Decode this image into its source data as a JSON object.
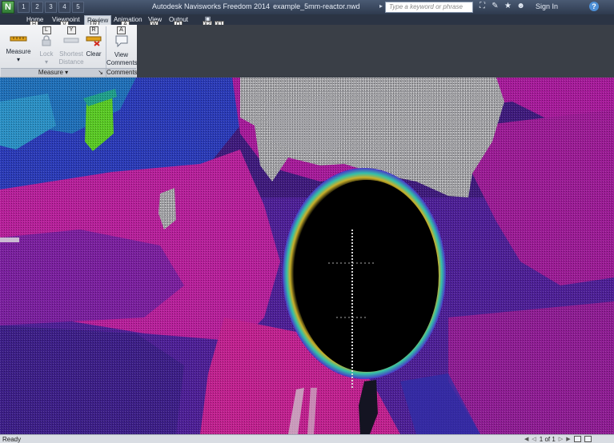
{
  "titlebar": {
    "app_menu_label": "N",
    "qat_keytips": [
      "1",
      "2",
      "3",
      "4",
      "5"
    ],
    "app_name": "Autodesk Navisworks Freedom 2014",
    "file_name": "example_5mm-reactor.nwd",
    "search_placeholder": "Type a keyword or phrase",
    "sign_in": "Sign In",
    "help": "?"
  },
  "tabs": [
    {
      "label": "Home",
      "keytip": "H",
      "active": false
    },
    {
      "label": "Viewpoint",
      "keytip": "V",
      "active": false
    },
    {
      "label": "Review",
      "keytip": "R",
      "active": true
    },
    {
      "label": "Animation",
      "keytip": "A",
      "active": false
    },
    {
      "label": "View",
      "keytip": "W",
      "active": false
    },
    {
      "label": "Output",
      "keytip": "O",
      "active": false
    }
  ],
  "extra_keytips": [
    "X2",
    "X1"
  ],
  "ribbon": {
    "measure": {
      "label": "Measure",
      "arrow": "▾"
    },
    "lock": {
      "label": "Lock",
      "arrow": "▾",
      "keytip": "L"
    },
    "shortest_distance": {
      "line1": "Shortest",
      "line2": "Distance",
      "keytip": "Y"
    },
    "clear": {
      "label": "Clear",
      "keytip": "R"
    },
    "view_comments": {
      "line1": "View",
      "line2": "Comments",
      "keytip": "A"
    },
    "panel_measure": "Measure ▾",
    "panel_measure_corner": "↘",
    "panel_comments": "Comments"
  },
  "status": {
    "text": "Ready",
    "page": "1 of 1"
  },
  "colors": {
    "magenta": "#c4208f",
    "purple": "#5a21a6",
    "blue": "#1f3fb0",
    "white_scan": "#d8d8d8",
    "green": "#59c924"
  }
}
